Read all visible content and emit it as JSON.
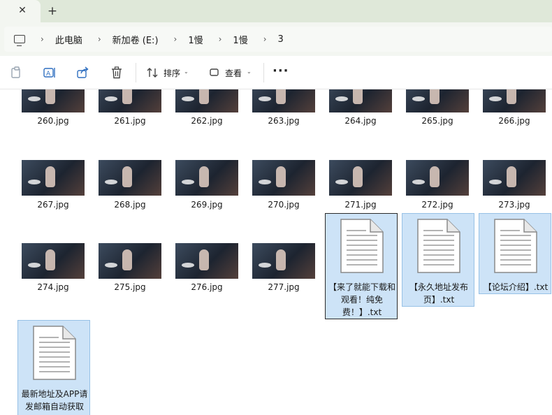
{
  "tabs": {
    "close_glyph": "✕",
    "new_tab_glyph": "+"
  },
  "breadcrumb": [
    "此电脑",
    "新加卷 (E:)",
    "1慢",
    "1慢",
    "3"
  ],
  "breadcrumb_separator": "›",
  "toolbar": {
    "sort_label": "排序",
    "view_label": "查看",
    "more_label": "···",
    "icons": [
      "copy-icon",
      "rename-icon",
      "share-icon",
      "delete-icon",
      "sort-icon",
      "view-icon"
    ]
  },
  "files": {
    "row1": [
      "260.jpg",
      "261.jpg",
      "262.jpg",
      "263.jpg",
      "264.jpg",
      "265.jpg",
      "266.jpg"
    ],
    "row2": [
      "267.jpg",
      "268.jpg",
      "269.jpg",
      "270.jpg",
      "271.jpg",
      "272.jpg",
      "273.jpg"
    ],
    "row3": [
      "274.jpg",
      "275.jpg",
      "276.jpg",
      "277.jpg"
    ],
    "txt": [
      "【来了就能下载和观看！纯免费！】.txt",
      "【永久地址发布页】.txt",
      "【论坛介绍】.txt",
      "最新地址及APP请发邮箱自动获取"
    ]
  },
  "colors": {
    "selection_bg": "#cde3f7",
    "selection_border": "#97c1e6",
    "tabstrip": "#dfe8d9",
    "chrome": "#f3f6f1"
  }
}
